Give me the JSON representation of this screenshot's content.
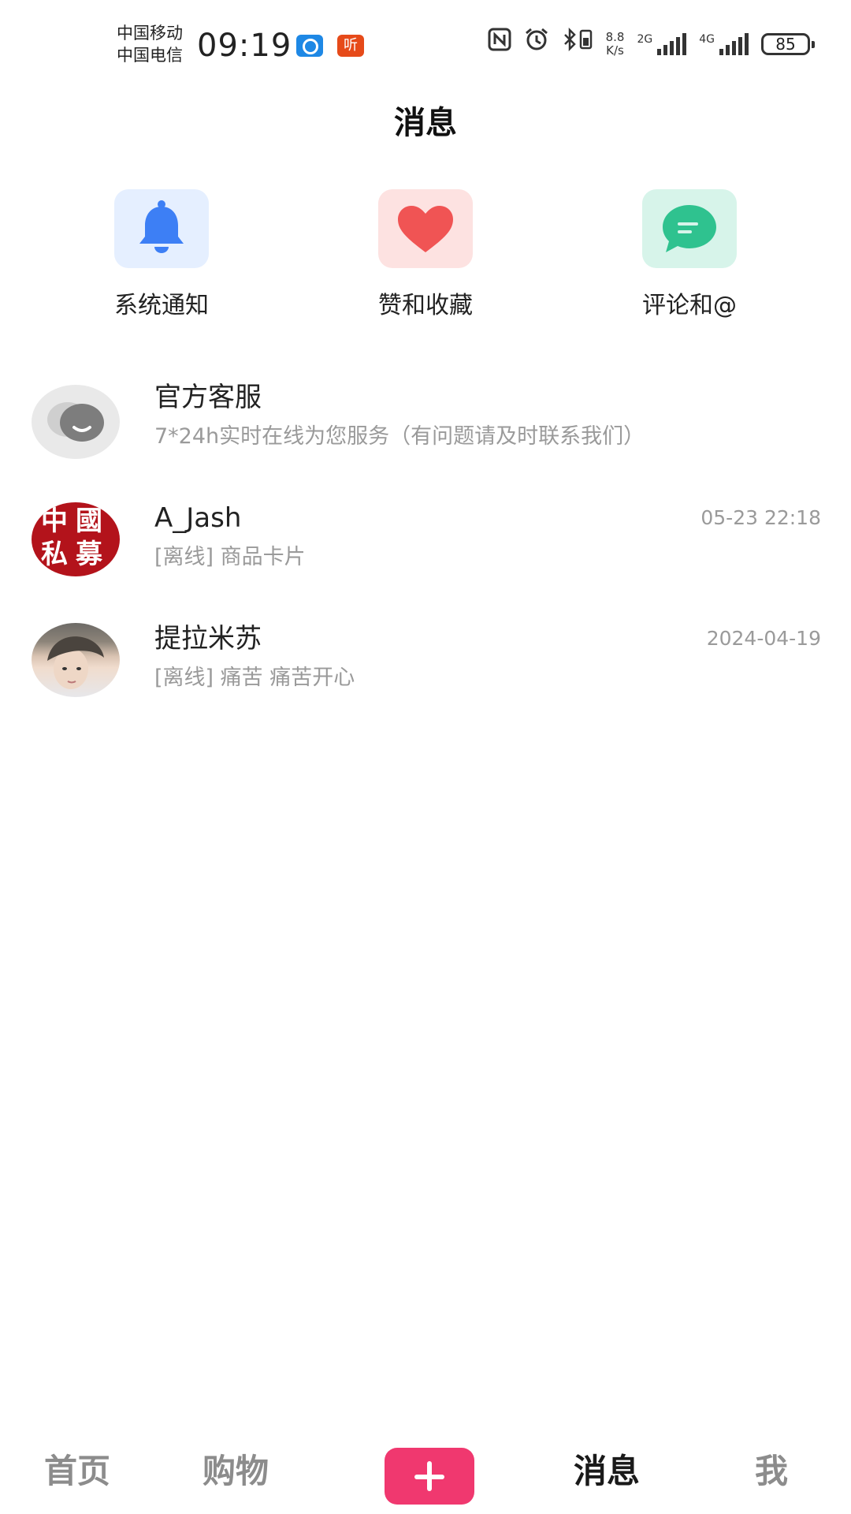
{
  "status_bar": {
    "carrier_1": "中国移动",
    "carrier_2": "中国电信",
    "time": "09:19",
    "app_icon_listen": "听",
    "net_speed_value": "8.8",
    "net_speed_unit": "K/s",
    "sim1_network": "2G",
    "sim2_network": "4G",
    "battery_level": "85",
    "icons": [
      "qq-browser-icon",
      "listen-app-icon",
      "nfc-icon",
      "alarm-icon",
      "bluetooth-icon",
      "signal-icon",
      "battery-icon"
    ]
  },
  "header": {
    "title": "消息"
  },
  "quick_entries": [
    {
      "label": "系统通知",
      "icon": "bell-icon",
      "color": "#3d7ff5"
    },
    {
      "label": "赞和收藏",
      "icon": "heart-icon",
      "color": "#f05454"
    },
    {
      "label": "评论和@",
      "icon": "chat-bubble-icon",
      "color": "#2fc28f"
    }
  ],
  "conversations": [
    {
      "name": "官方客服",
      "preview": "7*24h实时在线为您服务（有问题请及时联系我们）",
      "time": ""
    },
    {
      "name": "A_Jash",
      "preview": "[离线] 商品卡片",
      "time": "05-23 22:18",
      "avatar_text": [
        "中",
        "國",
        "私",
        "募"
      ]
    },
    {
      "name": "提拉米苏",
      "preview": "[离线] 痛苦 痛苦开心",
      "time": "2024-04-19"
    }
  ],
  "tabbar": {
    "items": [
      "首页",
      "购物",
      "消息",
      "我"
    ],
    "active": "消息",
    "accent_color": "#f0386f"
  }
}
